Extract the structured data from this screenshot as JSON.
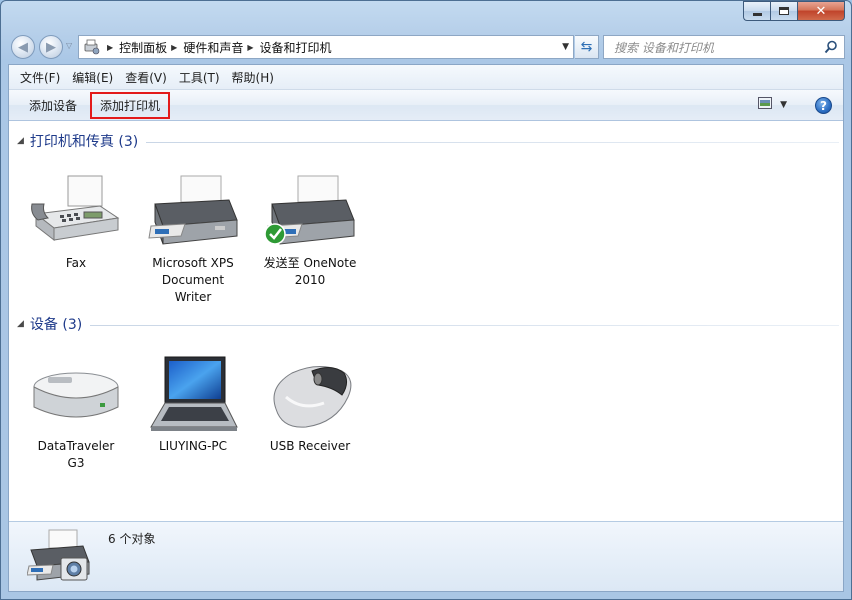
{
  "window": {
    "close_label": "✕"
  },
  "address": {
    "crumbs": [
      "控制面板",
      "硬件和声音",
      "设备和打印机"
    ]
  },
  "search": {
    "placeholder": "搜索 设备和打印机"
  },
  "menu": {
    "items": [
      "文件(F)",
      "编辑(E)",
      "查看(V)",
      "工具(T)",
      "帮助(H)"
    ]
  },
  "commands": {
    "add_device": "添加设备",
    "add_printer": "添加打印机",
    "help": "?"
  },
  "groups": {
    "printers": {
      "title": "打印机和传真 (3)",
      "devices": [
        {
          "label_line1": "Fax",
          "label_line2": "",
          "label_line3": "",
          "icon": "fax-icon"
        },
        {
          "label_line1": "Microsoft XPS",
          "label_line2": "Document",
          "label_line3": "Writer",
          "icon": "printer-icon"
        },
        {
          "label_line1": "发送至 OneNote",
          "label_line2": "2010",
          "label_line3": "",
          "icon": "default-printer-icon"
        }
      ]
    },
    "devices": {
      "title": "设备 (3)",
      "devices": [
        {
          "label_line1": "DataTraveler",
          "label_line2": "G3",
          "label_line3": "",
          "icon": "usb-drive-icon"
        },
        {
          "label_line1": "LIUYING-PC",
          "label_line2": "",
          "label_line3": "",
          "icon": "laptop-icon"
        },
        {
          "label_line1": "USB Receiver",
          "label_line2": "",
          "label_line3": "",
          "icon": "mouse-icon"
        }
      ]
    }
  },
  "details": {
    "count": "6 个对象"
  },
  "colors": {
    "group_title": "#1e3a8a",
    "highlight_border": "#e31a1a"
  }
}
